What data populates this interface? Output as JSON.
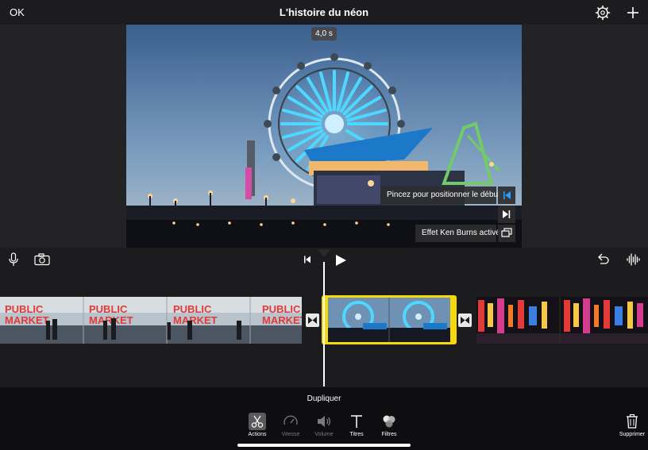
{
  "header": {
    "ok_label": "OK",
    "title": "L'histoire du néon",
    "settings_icon": "gear-icon",
    "add_icon": "plus-icon"
  },
  "viewer": {
    "duration_badge": "4,0 s",
    "hint_pinch": "Pincez pour positionner le début",
    "ken_burns_status": "Effet Ken Burns activé",
    "accent_color": "#2e9bff"
  },
  "controls": {
    "microphone_icon": "microphone-icon",
    "camera_icon": "camera-icon",
    "rewind_icon": "skip-to-start-icon",
    "play_icon": "play-icon",
    "undo_icon": "undo-icon",
    "audio_waveform_icon": "waveform-icon"
  },
  "timeline": {
    "clips": [
      {
        "content": "PUBLIC MARKET",
        "selected": false
      },
      {
        "content": "Ferris wheel pier",
        "selected": true
      },
      {
        "content": "Neon signs street",
        "selected": false
      }
    ],
    "selection_color": "#f5d90a"
  },
  "toolbar": {
    "action_title": "Dupliquer",
    "tools": [
      {
        "label": "Actions",
        "icon": "scissors-icon",
        "enabled": true,
        "active": true
      },
      {
        "label": "Vitesse",
        "icon": "speedometer-icon",
        "enabled": false,
        "active": false
      },
      {
        "label": "Volume",
        "icon": "speaker-icon",
        "enabled": false,
        "active": false
      },
      {
        "label": "Titres",
        "icon": "text-t-icon",
        "enabled": true,
        "active": false
      },
      {
        "label": "Filtres",
        "icon": "filters-icon",
        "enabled": true,
        "active": false
      }
    ],
    "delete_label": "Supprimer",
    "delete_icon": "trash-icon"
  }
}
